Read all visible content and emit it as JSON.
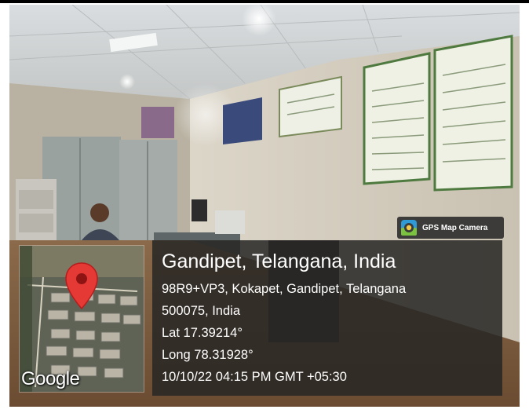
{
  "badge": {
    "label": "GPS Map Camera",
    "icon": "gps-map-camera-app-icon"
  },
  "map": {
    "logo_text": "Google",
    "pin_color": "#e53935",
    "icon": "location-pin-icon"
  },
  "location": {
    "title": "Gandipet, Telangana, India",
    "address_line1": "98R9+VP3, Kokapet, Gandipet, Telangana",
    "address_line2": "500075, India",
    "latitude": "Lat 17.39214°",
    "longitude": "Long 78.31928°",
    "timestamp": "10/10/22 04:15 PM GMT +05:30"
  },
  "colors": {
    "card_background": "#2a2725",
    "text": "#ffffff"
  }
}
